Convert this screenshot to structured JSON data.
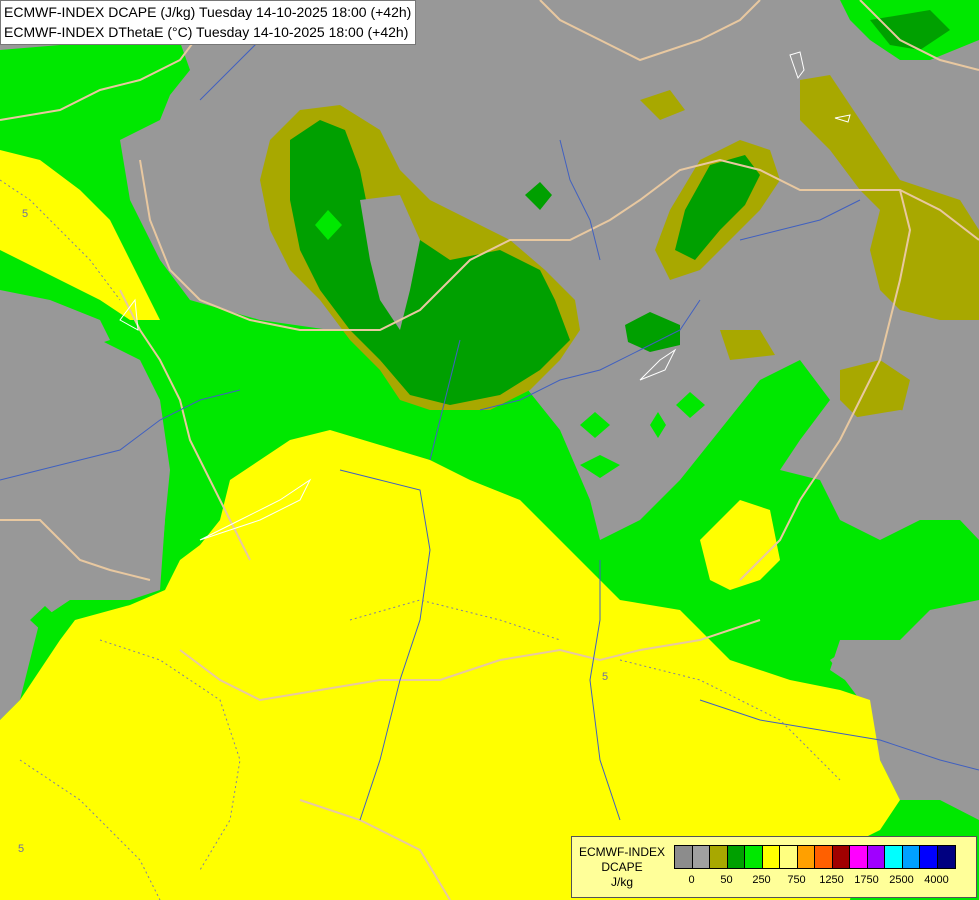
{
  "title": {
    "line1": "ECMWF-INDEX DCAPE (J/kg) Tuesday 14-10-2025 18:00 (+42h)",
    "line2": "ECMWF-INDEX DThetaE (°C) Tuesday 14-10-2025 18:00 (+42h)"
  },
  "colors": {
    "gray": "#989898",
    "olive": "#a8a800",
    "dark_green": "#00a000",
    "green": "#00e800",
    "yellow": "#ffff00",
    "border": "#e8c8a0",
    "river": "#4060c0",
    "contour_label": "5"
  },
  "legend": {
    "title_line1": "ECMWF-INDEX",
    "title_line2": "DCAPE",
    "unit": "J/kg",
    "swatch_colors": [
      "#8c8c8c",
      "#a0a0a0",
      "#a8a800",
      "#00a000",
      "#00e800",
      "#ffff00",
      "#ffff80",
      "#ffa000",
      "#ff6000",
      "#a00000",
      "#ff00ff",
      "#a000ff",
      "#00ffff",
      "#00a0ff",
      "#0000ff",
      "#000080"
    ],
    "ticks": [
      "0",
      "50",
      "250",
      "750",
      "1250",
      "1750",
      "2500",
      "4000"
    ]
  }
}
